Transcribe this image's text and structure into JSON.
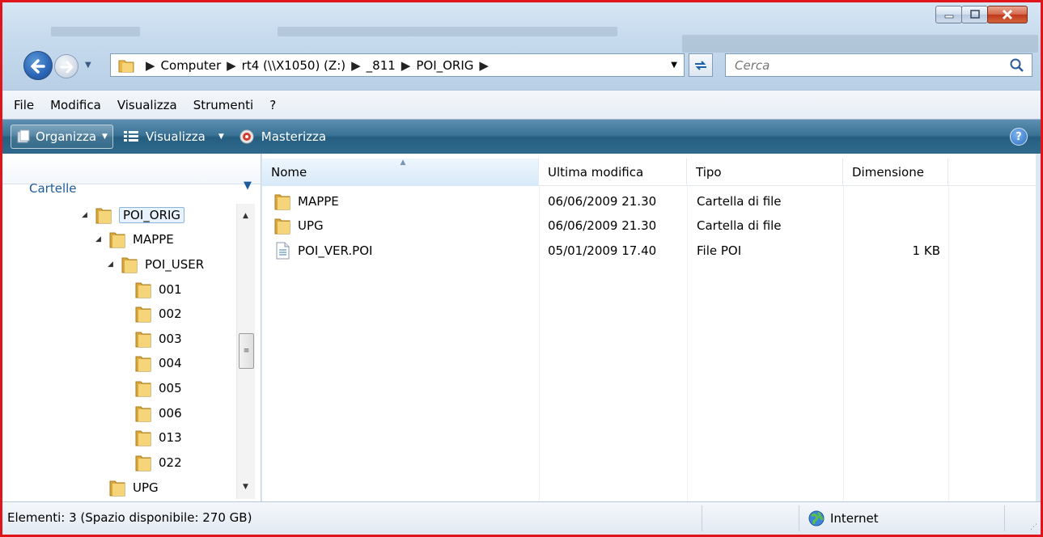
{
  "window": {
    "controls": {
      "minimize_icon": "minimize-icon",
      "maximize_icon": "maximize-icon",
      "close_icon": "close-icon"
    }
  },
  "address_bar": {
    "crumbs": [
      "Computer",
      "rt4 (\\\\X1050) (Z:)",
      "_811",
      "POI_ORIG"
    ]
  },
  "search": {
    "placeholder": "Cerca"
  },
  "menu": {
    "items": [
      "File",
      "Modifica",
      "Visualizza",
      "Strumenti",
      "?"
    ]
  },
  "toolbar": {
    "organize": "Organizza",
    "view": "Visualizza",
    "burn": "Masterizza"
  },
  "left_pane": {
    "title": "Cartelle",
    "tree": [
      {
        "label": "POI_ORIG",
        "level": 0,
        "expanded": true,
        "selected": true
      },
      {
        "label": "MAPPE",
        "level": 1,
        "expanded": true
      },
      {
        "label": "POI_USER",
        "level": 2,
        "expanded": true
      },
      {
        "label": "001",
        "level": 3
      },
      {
        "label": "002",
        "level": 3
      },
      {
        "label": "003",
        "level": 3
      },
      {
        "label": "004",
        "level": 3
      },
      {
        "label": "005",
        "level": 3
      },
      {
        "label": "006",
        "level": 3
      },
      {
        "label": "013",
        "level": 3
      },
      {
        "label": "022",
        "level": 3
      },
      {
        "label": "UPG",
        "level": 1
      }
    ]
  },
  "file_list": {
    "columns": [
      "Nome",
      "Ultima modifica",
      "Tipo",
      "Dimensione"
    ],
    "rows": [
      {
        "name": "MAPPE",
        "modified": "06/06/2009 21.30",
        "type": "Cartella di file",
        "size": "",
        "icon": "folder-icon"
      },
      {
        "name": "UPG",
        "modified": "06/06/2009 21.30",
        "type": "Cartella di file",
        "size": "",
        "icon": "folder-icon"
      },
      {
        "name": "POI_VER.POI",
        "modified": "05/01/2009 17.40",
        "type": "File POI",
        "size": "1 KB",
        "icon": "file-icon"
      }
    ]
  },
  "status_bar": {
    "text": "Elementi: 3 (Spazio disponibile: 270 GB)",
    "zone": "Internet"
  },
  "colors": {
    "window_border": "#e0151b",
    "cmdbar": "#2f6a8c",
    "accent": "#1c5a9e"
  }
}
